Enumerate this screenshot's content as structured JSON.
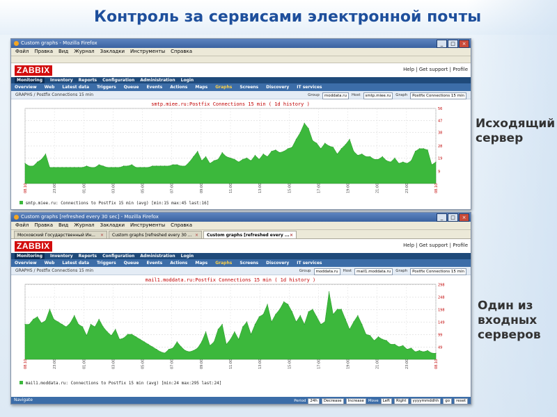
{
  "slide": {
    "title": "Контроль за сервисами электронной почты",
    "caption_outgoing": "Исходящий\nсервер",
    "caption_incoming": "Один из\nвходных\nсерверов"
  },
  "window1": {
    "title": "Custom graphs - Mozilla Firefox",
    "menu": [
      "Файл",
      "Правка",
      "Вид",
      "Журнал",
      "Закладки",
      "Инструменты",
      "Справка"
    ],
    "logo": "ZABBIX",
    "top_links": "Help | Get support | Profile",
    "nav_primary": [
      "Monitoring",
      "Inventory",
      "Reports",
      "Configuration",
      "Administration",
      "Login"
    ],
    "nav_primary_active": "Monitoring",
    "nav_secondary": [
      "Overview",
      "Web",
      "Latest data",
      "Triggers",
      "Queue",
      "Events",
      "Actions",
      "Maps",
      "Graphs",
      "Screens",
      "Discovery",
      "IT services"
    ],
    "nav_secondary_active": "Graphs",
    "breadcrumb": "GRAPHS / Postfix Connections 15 min",
    "group_label": "Group",
    "group_value": "moddata.ru",
    "host_label": "Host",
    "host_value": "smtp.miee.ru",
    "graph_label": "Graph",
    "graph_value": "Postfix Connections 15 min",
    "legend": "smtp.miee.ru: Connections to Postfix 15 min (avg) [min:15 max:45 last:16]"
  },
  "window2": {
    "title": "Custom graphs [refreshed every 30 sec] - Mozilla Firefox",
    "menu": [
      "Файл",
      "Правка",
      "Вид",
      "Журнал",
      "Закладки",
      "Инструменты",
      "Справка"
    ],
    "tabs": [
      "Московский Государственный Ин...",
      "Custom graphs [refreshed every 30 ...",
      "Custom graphs [refreshed every ..."
    ],
    "active_tab": 2,
    "logo": "ZABBIX",
    "top_links": "Help | Get support | Profile",
    "nav_primary": [
      "Monitoring",
      "Inventory",
      "Reports",
      "Configuration",
      "Administration",
      "Login"
    ],
    "nav_primary_active": "Monitoring",
    "nav_secondary": [
      "Overview",
      "Web",
      "Latest data",
      "Triggers",
      "Queue",
      "Events",
      "Actions",
      "Maps",
      "Graphs",
      "Screens",
      "Discovery",
      "IT services"
    ],
    "nav_secondary_active": "Graphs",
    "breadcrumb": "GRAPHS / Postfix Connections 15 min",
    "group_label": "Group",
    "group_value": "moddata.ru",
    "host_label": "Host",
    "host_value": "mail1.moddata.ru",
    "graph_label": "Graph",
    "graph_value": "Postfix Connections 15 min",
    "legend": "mail1.moddata.ru: Connections to Postfix 15 min (avg) [min:24 max:295 last:24]",
    "navigate": {
      "label": "Navigate",
      "period_label": "Period",
      "period_value": "24h",
      "decrease": "Decrease",
      "increase": "Increase",
      "move_label": "Move",
      "left": "Left",
      "right": "Right",
      "date_placeholder": "yyyymmddhh",
      "go": "go",
      "reset": "reset"
    }
  },
  "chart_data": [
    {
      "type": "area",
      "title": "smtp.miee.ru:Postfix Connections 15 min ( 1d history )",
      "color": "#3cb83c",
      "ylim": [
        0,
        56
      ],
      "yticks": [
        56,
        47,
        38,
        28,
        19,
        9
      ],
      "xticks": [
        "08.10",
        "23:00",
        "01:00",
        "03:00",
        "05:00",
        "07:00",
        "09:00",
        "11:00",
        "13:00",
        "15:00",
        "17:00",
        "19:00",
        "21:00",
        "23:00",
        "08.10"
      ],
      "values": [
        15,
        13,
        13,
        16,
        18,
        22,
        12,
        12,
        12,
        12,
        12,
        12,
        12,
        12,
        12,
        13,
        12,
        12,
        14,
        13,
        12,
        12,
        12,
        12,
        13,
        13,
        14,
        12,
        12,
        12,
        12,
        13,
        13,
        13,
        13,
        13,
        14,
        14,
        13,
        13,
        16,
        20,
        24,
        17,
        20,
        15,
        17,
        18,
        23,
        20,
        19,
        18,
        16,
        18,
        19,
        17,
        21,
        18,
        22,
        20,
        24,
        25,
        23,
        24,
        26,
        27,
        33,
        38,
        45,
        41,
        32,
        30,
        26,
        30,
        28,
        27,
        22,
        26,
        29,
        33,
        24,
        21,
        22,
        20,
        20,
        18,
        18,
        20,
        17,
        16,
        19,
        15,
        16,
        15,
        17,
        24,
        26,
        26,
        25,
        14,
        16
      ]
    },
    {
      "type": "area",
      "title": "mail1.moddata.ru:Postfix Connections 15 min ( 1d history )",
      "color": "#3cb83c",
      "ylim": [
        0,
        300
      ],
      "yticks": [
        298,
        248,
        198,
        149,
        99,
        49
      ],
      "xticks": [
        "08.10",
        "23:00",
        "01:00",
        "03:00",
        "05:00",
        "07:00",
        "09:00",
        "11:00",
        "13:00",
        "15:00",
        "17:00",
        "19:00",
        "21:00",
        "23:00",
        "08.10"
      ],
      "values": [
        140,
        140,
        160,
        170,
        145,
        155,
        200,
        160,
        150,
        140,
        130,
        145,
        175,
        140,
        130,
        95,
        140,
        130,
        160,
        130,
        110,
        95,
        120,
        80,
        85,
        100,
        100,
        90,
        80,
        70,
        60,
        50,
        40,
        30,
        25,
        40,
        45,
        70,
        50,
        35,
        30,
        35,
        45,
        70,
        110,
        55,
        70,
        120,
        140,
        60,
        80,
        110,
        80,
        130,
        150,
        100,
        140,
        170,
        180,
        220,
        150,
        180,
        200,
        230,
        220,
        190,
        150,
        175,
        140,
        190,
        200,
        170,
        140,
        150,
        270,
        180,
        200,
        200,
        160,
        120,
        150,
        175,
        140,
        100,
        95,
        75,
        90,
        80,
        75,
        60,
        60,
        50,
        55,
        40,
        45,
        30,
        35,
        30,
        35,
        25,
        24
      ]
    }
  ]
}
